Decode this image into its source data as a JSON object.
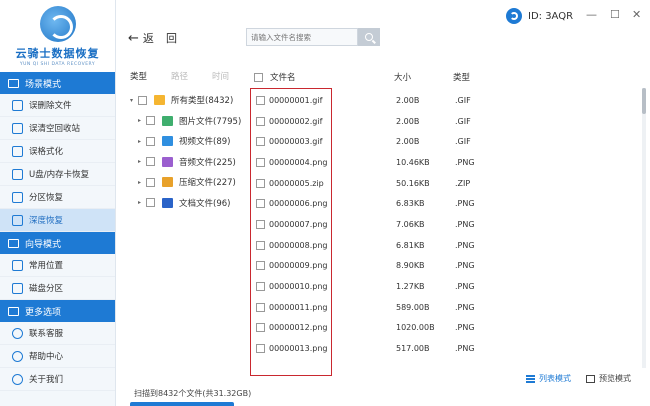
{
  "app": {
    "title": "云骑士数据恢复",
    "subtitle": "YUN QI SHI DATA RECOVERY",
    "user_id": "ID: 3AQR",
    "window_controls": [
      "—",
      "☐",
      "✕"
    ],
    "accent": "#1e7ad4"
  },
  "sidebar": {
    "sections": [
      {
        "label": "场景模式",
        "items": [
          {
            "label": "误删除文件"
          },
          {
            "label": "误清空回收站"
          },
          {
            "label": "误格式化"
          },
          {
            "label": "U盘/内存卡恢复"
          },
          {
            "label": "分区恢复"
          },
          {
            "label": "深度恢复",
            "active": true
          }
        ]
      },
      {
        "label": "向导模式",
        "items": [
          {
            "label": "常用位置"
          },
          {
            "label": "磁盘分区"
          }
        ]
      },
      {
        "label": "更多选项",
        "items": [
          {
            "label": "联系客服"
          },
          {
            "label": "帮助中心"
          },
          {
            "label": "关于我们"
          }
        ]
      }
    ]
  },
  "toolbar": {
    "back_label": "返",
    "home_label": "回",
    "search_placeholder": "请输入文件名搜索"
  },
  "category_tabs": [
    "类型",
    "路径",
    "时间"
  ],
  "tree": [
    {
      "label": "所有类型(8432)",
      "root": true,
      "color": "#f5b531"
    },
    {
      "label": "图片文件(7795)",
      "color": "#3fae6e"
    },
    {
      "label": "视频文件(89)",
      "color": "#2f8fe0"
    },
    {
      "label": "音频文件(225)",
      "color": "#9b5fcf"
    },
    {
      "label": "压缩文件(227)",
      "color": "#e8a12a"
    },
    {
      "label": "文档文件(96)",
      "color": "#2a63c8"
    }
  ],
  "list_headers": {
    "name": "文件名",
    "size": "大小",
    "type": "类型"
  },
  "files": [
    {
      "name": "00000001.gif",
      "size": "2.00B",
      "type": ".GIF"
    },
    {
      "name": "00000002.gif",
      "size": "2.00B",
      "type": ".GIF"
    },
    {
      "name": "00000003.gif",
      "size": "2.00B",
      "type": ".GIF"
    },
    {
      "name": "00000004.png",
      "size": "10.46KB",
      "type": ".PNG"
    },
    {
      "name": "00000005.zip",
      "size": "50.16KB",
      "type": ".ZIP"
    },
    {
      "name": "00000006.png",
      "size": "6.83KB",
      "type": ".PNG"
    },
    {
      "name": "00000007.png",
      "size": "7.06KB",
      "type": ".PNG"
    },
    {
      "name": "00000008.png",
      "size": "6.81KB",
      "type": ".PNG"
    },
    {
      "name": "00000009.png",
      "size": "8.90KB",
      "type": ".PNG"
    },
    {
      "name": "00000010.png",
      "size": "1.27KB",
      "type": ".PNG"
    },
    {
      "name": "00000011.png",
      "size": "589.00B",
      "type": ".PNG"
    },
    {
      "name": "00000012.png",
      "size": "1020.00B",
      "type": ".PNG"
    },
    {
      "name": "00000013.png",
      "size": "517.00B",
      "type": ".PNG"
    }
  ],
  "view_modes": {
    "list": "列表模式",
    "preview": "预览模式"
  },
  "status_text": "扫描到8432个文件(共31.32GB)"
}
